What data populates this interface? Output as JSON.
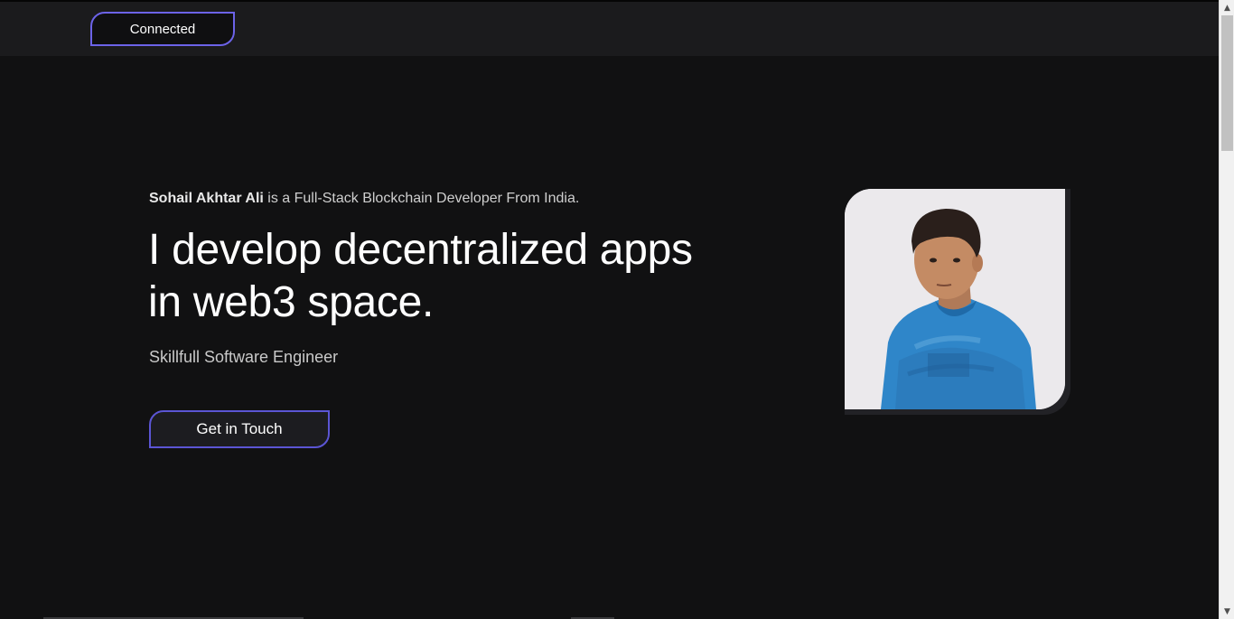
{
  "navbar": {
    "connect_label": "Connected"
  },
  "hero": {
    "intro_name": "Sohail Akhtar Ali",
    "intro_rest": " is a Full-Stack Blockchain Developer From India.",
    "headline_line1": "I develop decentralized apps",
    "headline_line2": "in web3 space.",
    "role": "Skillfull Software Engineer",
    "cta_label": "Get in Touch"
  },
  "portrait": {
    "icon": "profile-photo"
  },
  "colors": {
    "background": "#111112",
    "navbar": "#1b1b1d",
    "accent_border": "#6c63e8",
    "shirt_blue": "#2f86c9"
  }
}
